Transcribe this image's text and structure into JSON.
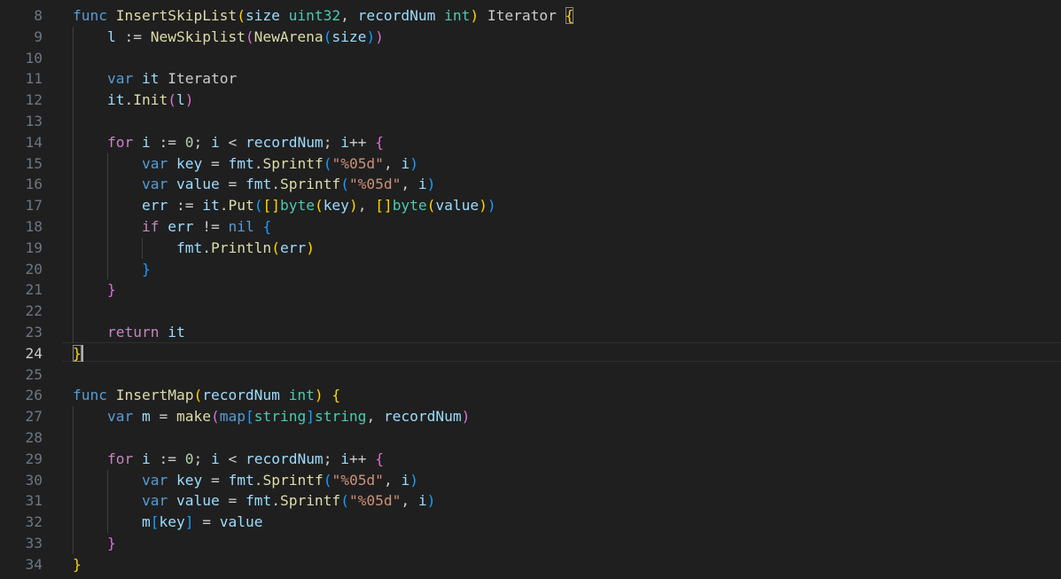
{
  "editor": {
    "language": "go",
    "active_line": 24,
    "colors": {
      "background": "#1f1f1f",
      "line_number": "#6e7681",
      "keyword": "#569cd6",
      "control": "#c586c0",
      "function": "#dcdcaa",
      "type": "#4ec9b0",
      "variable": "#9cdcfe",
      "string": "#ce9178",
      "number": "#b5cea8",
      "bracket_level1": "#ffd700",
      "bracket_level2": "#da70d6",
      "bracket_level3": "#179fff"
    },
    "lines": [
      {
        "num": "8",
        "tokens": [
          [
            "func",
            "kw"
          ],
          [
            " ",
            "plain"
          ],
          [
            "InsertSkipList",
            "fn"
          ],
          [
            "(",
            "b1"
          ],
          [
            "size",
            "var"
          ],
          [
            " ",
            "plain"
          ],
          [
            "uint32",
            "type"
          ],
          [
            ", ",
            "plain"
          ],
          [
            "recordNum",
            "var"
          ],
          [
            " ",
            "plain"
          ],
          [
            "int",
            "type"
          ],
          [
            ")",
            "b1"
          ],
          [
            " Iterator ",
            "plain"
          ],
          [
            "{",
            "b1"
          ]
        ]
      },
      {
        "num": "9",
        "tokens": [
          [
            "    ",
            "plain"
          ],
          [
            "l",
            "var"
          ],
          [
            " := ",
            "plain"
          ],
          [
            "NewSkiplist",
            "fn"
          ],
          [
            "(",
            "b2"
          ],
          [
            "NewArena",
            "fn"
          ],
          [
            "(",
            "b3"
          ],
          [
            "size",
            "var"
          ],
          [
            ")",
            "b3"
          ],
          [
            ")",
            "b2"
          ]
        ]
      },
      {
        "num": "10",
        "tokens": []
      },
      {
        "num": "11",
        "tokens": [
          [
            "    ",
            "plain"
          ],
          [
            "var",
            "kw"
          ],
          [
            " ",
            "plain"
          ],
          [
            "it",
            "var"
          ],
          [
            " Iterator",
            "plain"
          ]
        ]
      },
      {
        "num": "12",
        "tokens": [
          [
            "    ",
            "plain"
          ],
          [
            "it",
            "var"
          ],
          [
            ".",
            "plain"
          ],
          [
            "Init",
            "fn"
          ],
          [
            "(",
            "b2"
          ],
          [
            "l",
            "var"
          ],
          [
            ")",
            "b2"
          ]
        ]
      },
      {
        "num": "13",
        "tokens": []
      },
      {
        "num": "14",
        "tokens": [
          [
            "    ",
            "plain"
          ],
          [
            "for",
            "ctrl"
          ],
          [
            " ",
            "plain"
          ],
          [
            "i",
            "var"
          ],
          [
            " := ",
            "plain"
          ],
          [
            "0",
            "num"
          ],
          [
            "; ",
            "plain"
          ],
          [
            "i",
            "var"
          ],
          [
            " < ",
            "plain"
          ],
          [
            "recordNum",
            "var"
          ],
          [
            "; ",
            "plain"
          ],
          [
            "i",
            "var"
          ],
          [
            "++ ",
            "plain"
          ],
          [
            "{",
            "b2"
          ]
        ]
      },
      {
        "num": "15",
        "tokens": [
          [
            "        ",
            "plain"
          ],
          [
            "var",
            "kw"
          ],
          [
            " ",
            "plain"
          ],
          [
            "key",
            "var"
          ],
          [
            " = ",
            "plain"
          ],
          [
            "fmt",
            "var"
          ],
          [
            ".",
            "plain"
          ],
          [
            "Sprintf",
            "fn"
          ],
          [
            "(",
            "b3"
          ],
          [
            "\"%05d\"",
            "str"
          ],
          [
            ", ",
            "plain"
          ],
          [
            "i",
            "var"
          ],
          [
            ")",
            "b3"
          ]
        ]
      },
      {
        "num": "16",
        "tokens": [
          [
            "        ",
            "plain"
          ],
          [
            "var",
            "kw"
          ],
          [
            " ",
            "plain"
          ],
          [
            "value",
            "var"
          ],
          [
            " = ",
            "plain"
          ],
          [
            "fmt",
            "var"
          ],
          [
            ".",
            "plain"
          ],
          [
            "Sprintf",
            "fn"
          ],
          [
            "(",
            "b3"
          ],
          [
            "\"%05d\"",
            "str"
          ],
          [
            ", ",
            "plain"
          ],
          [
            "i",
            "var"
          ],
          [
            ")",
            "b3"
          ]
        ]
      },
      {
        "num": "17",
        "tokens": [
          [
            "        ",
            "plain"
          ],
          [
            "err",
            "var"
          ],
          [
            " := ",
            "plain"
          ],
          [
            "it",
            "var"
          ],
          [
            ".",
            "plain"
          ],
          [
            "Put",
            "fn"
          ],
          [
            "(",
            "b3"
          ],
          [
            "[]",
            "b1"
          ],
          [
            "byte",
            "type"
          ],
          [
            "(",
            "b1"
          ],
          [
            "key",
            "var"
          ],
          [
            ")",
            "b1"
          ],
          [
            ", ",
            "plain"
          ],
          [
            "[]",
            "b1"
          ],
          [
            "byte",
            "type"
          ],
          [
            "(",
            "b1"
          ],
          [
            "value",
            "var"
          ],
          [
            ")",
            "b1"
          ],
          [
            ")",
            "b3"
          ]
        ]
      },
      {
        "num": "18",
        "tokens": [
          [
            "        ",
            "plain"
          ],
          [
            "if",
            "ctrl"
          ],
          [
            " ",
            "plain"
          ],
          [
            "err",
            "var"
          ],
          [
            " != ",
            "plain"
          ],
          [
            "nil",
            "kw"
          ],
          [
            " ",
            "plain"
          ],
          [
            "{",
            "b3"
          ]
        ]
      },
      {
        "num": "19",
        "tokens": [
          [
            "            ",
            "plain"
          ],
          [
            "fmt",
            "var"
          ],
          [
            ".",
            "plain"
          ],
          [
            "Println",
            "fn"
          ],
          [
            "(",
            "b1"
          ],
          [
            "err",
            "var"
          ],
          [
            ")",
            "b1"
          ]
        ]
      },
      {
        "num": "20",
        "tokens": [
          [
            "        ",
            "plain"
          ],
          [
            "}",
            "b3"
          ]
        ]
      },
      {
        "num": "21",
        "tokens": [
          [
            "    ",
            "plain"
          ],
          [
            "}",
            "b2"
          ]
        ]
      },
      {
        "num": "22",
        "tokens": []
      },
      {
        "num": "23",
        "tokens": [
          [
            "    ",
            "plain"
          ],
          [
            "return",
            "ctrl"
          ],
          [
            " ",
            "plain"
          ],
          [
            "it",
            "var"
          ]
        ]
      },
      {
        "num": "24",
        "tokens": [
          [
            "}",
            "b1"
          ]
        ]
      },
      {
        "num": "25",
        "tokens": []
      },
      {
        "num": "26",
        "tokens": [
          [
            "func",
            "kw"
          ],
          [
            " ",
            "plain"
          ],
          [
            "InsertMap",
            "fn"
          ],
          [
            "(",
            "b1"
          ],
          [
            "recordNum",
            "var"
          ],
          [
            " ",
            "plain"
          ],
          [
            "int",
            "type"
          ],
          [
            ")",
            "b1"
          ],
          [
            " ",
            "plain"
          ],
          [
            "{",
            "b1"
          ]
        ]
      },
      {
        "num": "27",
        "tokens": [
          [
            "    ",
            "plain"
          ],
          [
            "var",
            "kw"
          ],
          [
            " ",
            "plain"
          ],
          [
            "m",
            "var"
          ],
          [
            " = ",
            "plain"
          ],
          [
            "make",
            "fn"
          ],
          [
            "(",
            "b2"
          ],
          [
            "map",
            "kw"
          ],
          [
            "[",
            "b3"
          ],
          [
            "string",
            "type"
          ],
          [
            "]",
            "b3"
          ],
          [
            "string",
            "type"
          ],
          [
            ", ",
            "plain"
          ],
          [
            "recordNum",
            "var"
          ],
          [
            ")",
            "b2"
          ]
        ]
      },
      {
        "num": "28",
        "tokens": []
      },
      {
        "num": "29",
        "tokens": [
          [
            "    ",
            "plain"
          ],
          [
            "for",
            "ctrl"
          ],
          [
            " ",
            "plain"
          ],
          [
            "i",
            "var"
          ],
          [
            " := ",
            "plain"
          ],
          [
            "0",
            "num"
          ],
          [
            "; ",
            "plain"
          ],
          [
            "i",
            "var"
          ],
          [
            " < ",
            "plain"
          ],
          [
            "recordNum",
            "var"
          ],
          [
            "; ",
            "plain"
          ],
          [
            "i",
            "var"
          ],
          [
            "++ ",
            "plain"
          ],
          [
            "{",
            "b2"
          ]
        ]
      },
      {
        "num": "30",
        "tokens": [
          [
            "        ",
            "plain"
          ],
          [
            "var",
            "kw"
          ],
          [
            " ",
            "plain"
          ],
          [
            "key",
            "var"
          ],
          [
            " = ",
            "plain"
          ],
          [
            "fmt",
            "var"
          ],
          [
            ".",
            "plain"
          ],
          [
            "Sprintf",
            "fn"
          ],
          [
            "(",
            "b3"
          ],
          [
            "\"%05d\"",
            "str"
          ],
          [
            ", ",
            "plain"
          ],
          [
            "i",
            "var"
          ],
          [
            ")",
            "b3"
          ]
        ]
      },
      {
        "num": "31",
        "tokens": [
          [
            "        ",
            "plain"
          ],
          [
            "var",
            "kw"
          ],
          [
            " ",
            "plain"
          ],
          [
            "value",
            "var"
          ],
          [
            " = ",
            "plain"
          ],
          [
            "fmt",
            "var"
          ],
          [
            ".",
            "plain"
          ],
          [
            "Sprintf",
            "fn"
          ],
          [
            "(",
            "b3"
          ],
          [
            "\"%05d\"",
            "str"
          ],
          [
            ", ",
            "plain"
          ],
          [
            "i",
            "var"
          ],
          [
            ")",
            "b3"
          ]
        ]
      },
      {
        "num": "32",
        "tokens": [
          [
            "        ",
            "plain"
          ],
          [
            "m",
            "var"
          ],
          [
            "[",
            "b3"
          ],
          [
            "key",
            "var"
          ],
          [
            "]",
            "b3"
          ],
          [
            " = ",
            "plain"
          ],
          [
            "value",
            "var"
          ]
        ]
      },
      {
        "num": "33",
        "tokens": [
          [
            "    ",
            "plain"
          ],
          [
            "}",
            "b2"
          ]
        ]
      },
      {
        "num": "34",
        "tokens": [
          [
            "}",
            "b1"
          ]
        ]
      }
    ]
  }
}
